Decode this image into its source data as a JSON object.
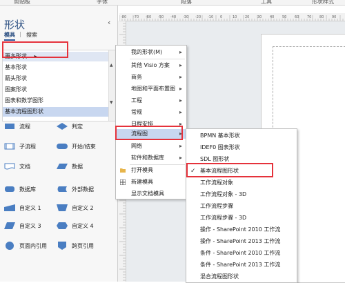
{
  "ribbon": {
    "groups": [
      "剪贴板",
      "字体",
      "段落",
      "工具",
      "形状样式"
    ]
  },
  "pane": {
    "title": "形状",
    "tabs": {
      "stencils": "模具",
      "search": "搜索"
    },
    "more_shapes": "更多形状",
    "stencils": [
      "基本形状",
      "箭头形状",
      "图案形状",
      "图表和数学图形",
      "基本流程图形状"
    ],
    "shapes": [
      {
        "label": "流程",
        "icon": "rect-shape"
      },
      {
        "label": "判定",
        "icon": "diamond-shape"
      },
      {
        "label": "子流程",
        "icon": "subprocess-shape"
      },
      {
        "label": "开始/结束",
        "icon": "terminator-shape"
      },
      {
        "label": "文档",
        "icon": "document-shape"
      },
      {
        "label": "数据",
        "icon": "parallelogram-shape"
      },
      {
        "label": "数据库",
        "icon": "database-shape"
      },
      {
        "label": "外部数据",
        "icon": "external-data-shape"
      },
      {
        "label": "自定义 1",
        "icon": "custom1-shape"
      },
      {
        "label": "自定义 2",
        "icon": "custom2-shape"
      },
      {
        "label": "自定义 3",
        "icon": "custom3-shape"
      },
      {
        "label": "自定义 4",
        "icon": "custom4-shape"
      },
      {
        "label": "页面内引用",
        "icon": "circle-shape"
      },
      {
        "label": "跨页引用",
        "icon": "offpage-shape"
      }
    ]
  },
  "menu1": {
    "items": [
      {
        "label": "我的形状(M)",
        "submenu": true
      },
      {
        "label": "其他 Visio 方案",
        "submenu": true
      },
      {
        "label": "商务",
        "submenu": true
      },
      {
        "label": "地图和平面布置图",
        "submenu": true
      },
      {
        "label": "工程",
        "submenu": true
      },
      {
        "label": "常规",
        "submenu": true
      },
      {
        "label": "日程安排",
        "submenu": true
      },
      {
        "label": "流程图",
        "submenu": true
      },
      {
        "label": "网络",
        "submenu": true
      },
      {
        "label": "软件和数据库",
        "submenu": true
      },
      {
        "label": "打开模具",
        "submenu": false
      },
      {
        "label": "新建模具",
        "submenu": false
      },
      {
        "label": "显示文档模具",
        "submenu": false
      }
    ]
  },
  "menu2": {
    "items": [
      {
        "label": "BPMN 基本形状",
        "checked": false
      },
      {
        "label": "IDEF0 图表形状",
        "checked": false
      },
      {
        "label": "SDL 图形状",
        "checked": false
      },
      {
        "label": "基本流程图形状",
        "checked": true
      },
      {
        "label": "工作流程对象",
        "checked": false
      },
      {
        "label": "工作流程对象 - 3D",
        "checked": false
      },
      {
        "label": "工作流程步骤",
        "checked": false
      },
      {
        "label": "工作流程步骤 - 3D",
        "checked": false
      },
      {
        "label": "操作 - SharePoint 2010 工作流",
        "checked": false
      },
      {
        "label": "操作 - SharePoint 2013 工作流",
        "checked": false
      },
      {
        "label": "条件 - SharePoint 2010 工作流",
        "checked": false
      },
      {
        "label": "条件 - SharePoint 2013 工作流",
        "checked": false
      },
      {
        "label": "混合流程图形状",
        "checked": false
      }
    ]
  },
  "ruler": {
    "h_ticks": [
      "-80",
      "-70",
      "-60",
      "-50",
      "-40",
      "-30",
      "-20",
      "-10",
      "0",
      "10",
      "20",
      "30",
      "40",
      "50",
      "60",
      "70",
      "80",
      "90"
    ]
  },
  "colors": {
    "accent": "#2b579a",
    "highlight": "#c8d7f0",
    "annotation": "#e5323b"
  }
}
